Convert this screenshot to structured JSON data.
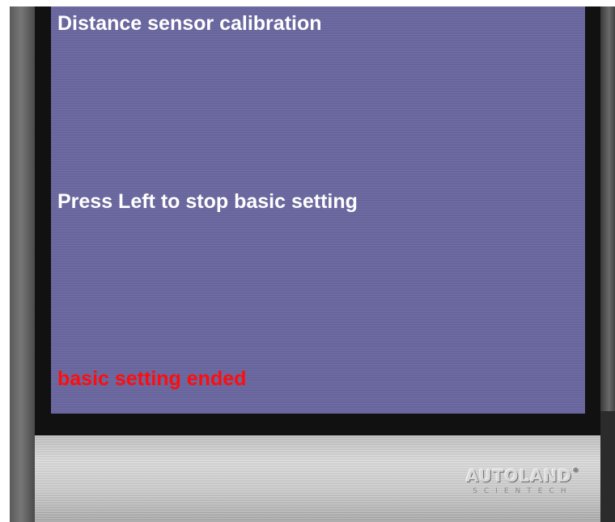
{
  "screen": {
    "title": "Distance sensor calibration",
    "instruction": "Press Left to stop basic setting",
    "status": "basic setting ended"
  },
  "brand": {
    "name": "AUTOLAND",
    "registered_mark": "®",
    "subtitle": "SCIENTECH"
  },
  "colors": {
    "screen_background": "#6a68a0",
    "primary_text": "#ffffff",
    "status_text": "#ff0d0d"
  }
}
